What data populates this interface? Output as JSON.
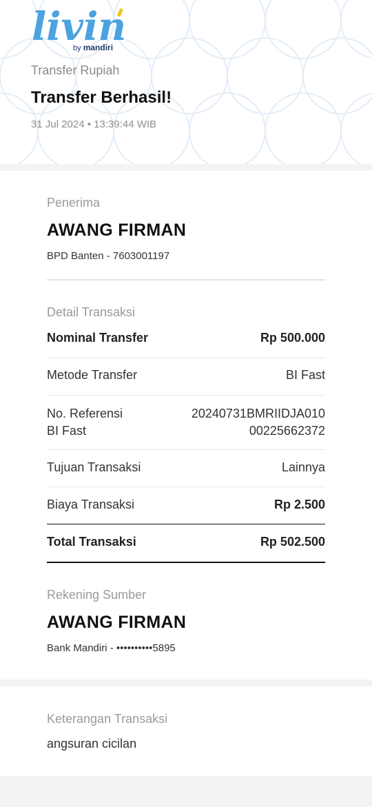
{
  "header": {
    "logo": {
      "word": "livin'",
      "by": "by",
      "brand": "mandiri"
    },
    "subtitle": "Transfer Rupiah",
    "title": "Transfer Berhasil!",
    "datetime": "31 Jul 2024 • 13:39:44 WIB"
  },
  "recipient": {
    "label": "Penerima",
    "name": "AWANG FIRMAN",
    "bank_account": "BPD Banten - 7603001197"
  },
  "details": {
    "label": "Detail Transaksi",
    "rows": [
      {
        "label": "Nominal Transfer",
        "value": "Rp 500.000"
      },
      {
        "label": "Metode Transfer",
        "value": "BI Fast"
      },
      {
        "label_line1": "No. Referensi",
        "label_line2": "BI Fast",
        "value_line1": "20240731BMRIIDJA010",
        "value_line2": "00225662372"
      },
      {
        "label": "Tujuan Transaksi",
        "value": "Lainnya"
      },
      {
        "label": "Biaya Transaksi",
        "value": "Rp 2.500"
      },
      {
        "label": "Total Transaksi",
        "value": "Rp 502.500"
      }
    ]
  },
  "source": {
    "label": "Rekening Sumber",
    "name": "AWANG FIRMAN",
    "bank_account": "Bank Mandiri - ••••••••••5895"
  },
  "note": {
    "label": "Keterangan Transaksi",
    "value": "angsuran cicilan"
  },
  "colors": {
    "logo_blue": "#4aa3df",
    "logo_accent": "#f4c21b",
    "pattern": "#e3edf7"
  }
}
